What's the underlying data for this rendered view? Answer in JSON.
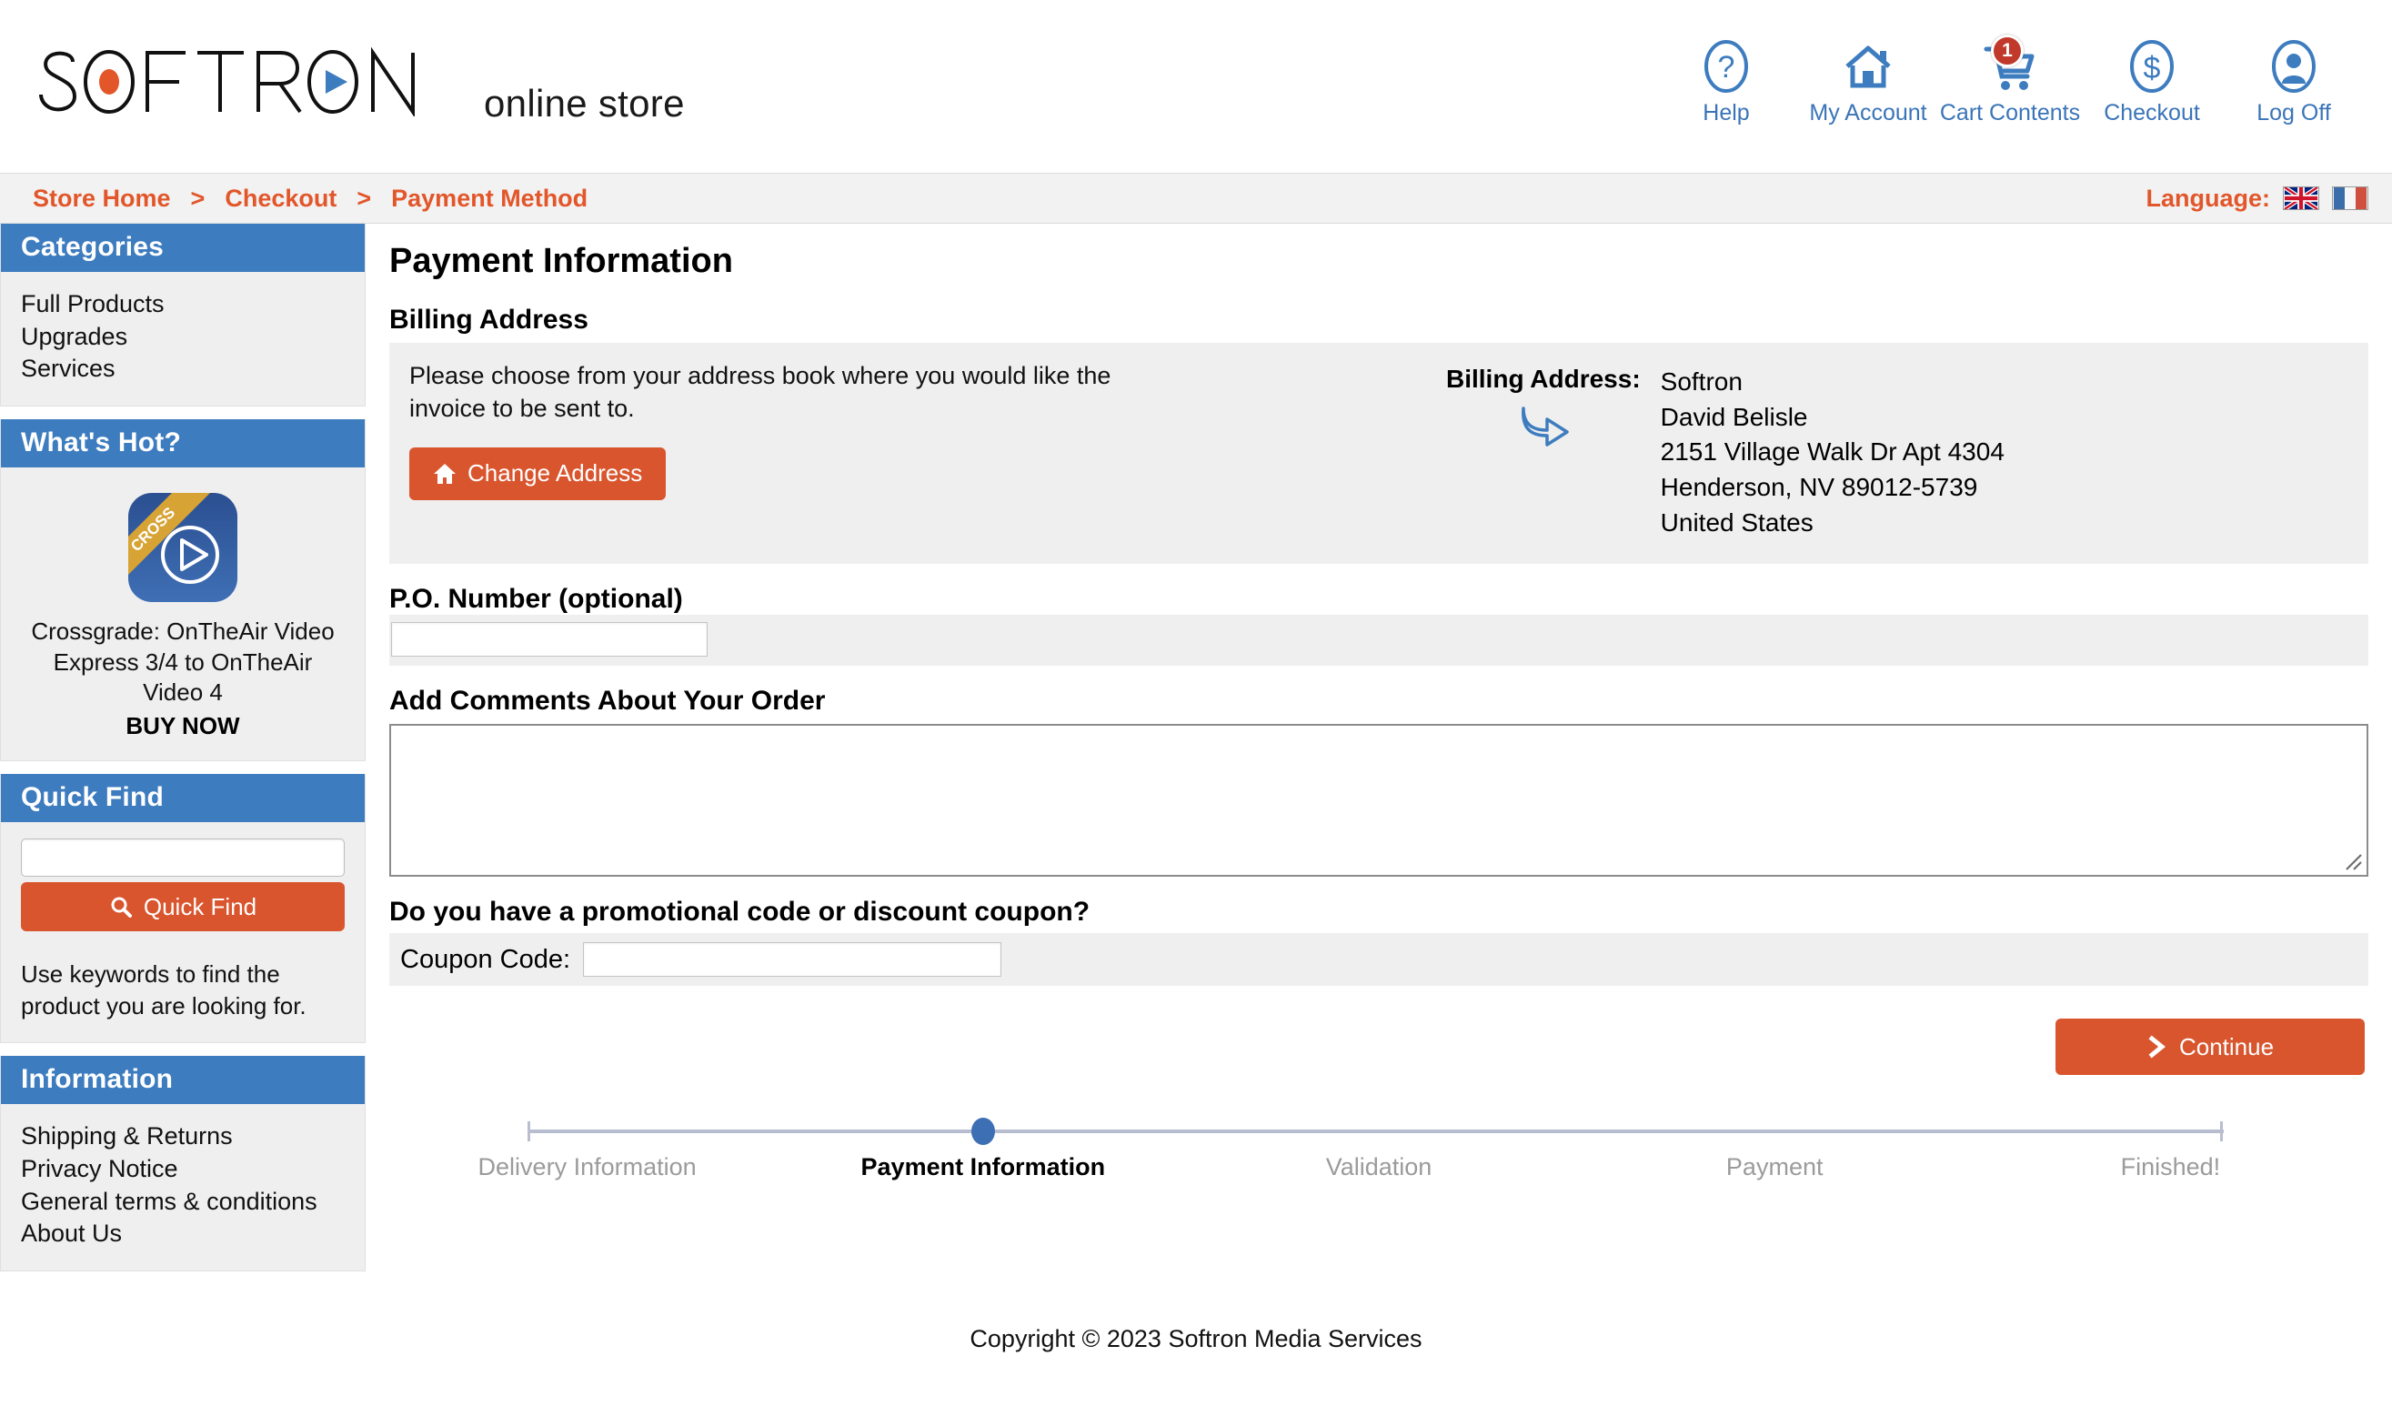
{
  "brand": {
    "logo_text": "SOFTRON",
    "logo_tagline": "online store",
    "accent_orange": "#d9552e",
    "accent_blue": "#3d7cbf",
    "badge_red": "#c0392b"
  },
  "header": {
    "nav": [
      {
        "label": "Help",
        "icon": "help-circle-icon"
      },
      {
        "label": "My Account",
        "icon": "home-icon"
      },
      {
        "label": "Cart Contents",
        "icon": "shopping-cart-icon",
        "badge": "1"
      },
      {
        "label": "Checkout",
        "icon": "dollar-circle-icon"
      },
      {
        "label": "Log Off",
        "icon": "user-circle-icon"
      }
    ]
  },
  "breadcrumb": {
    "items": [
      "Store Home",
      "Checkout",
      "Payment Method"
    ],
    "separator": ">",
    "language_label": "Language:",
    "languages": [
      "english-flag",
      "french-flag"
    ]
  },
  "sidebar": {
    "categories": {
      "title": "Categories",
      "items": [
        "Full Products",
        "Upgrades",
        "Services"
      ]
    },
    "whats_hot": {
      "title": "What's Hot?",
      "product_icon": "onthe-air-video-app-icon",
      "ribbon_text": "CROSS",
      "product_name": "Crossgrade: OnTheAir Video Express 3/4 to OnTheAir Video 4",
      "buy_label": "BUY NOW"
    },
    "quick_find": {
      "title": "Quick Find",
      "input_value": "",
      "input_placeholder": "",
      "button_label": "Quick Find",
      "button_icon": "search-icon",
      "hint": "Use keywords to find the product you are looking for."
    },
    "information": {
      "title": "Information",
      "items": [
        "Shipping & Returns",
        "Privacy Notice",
        "General terms & conditions",
        "About Us"
      ]
    }
  },
  "main": {
    "page_title": "Payment Information",
    "billing": {
      "section_title": "Billing Address",
      "instructions": "Please choose from your address book where you would like the invoice to be sent to.",
      "change_button_label": "Change Address",
      "change_button_icon": "home-icon",
      "address_label": "Billing Address:",
      "arrow_icon": "curved-arrow-right-icon",
      "address_lines": [
        "Softron",
        "David Belisle",
        "2151 Village Walk Dr Apt 4304",
        "Henderson, NV 89012-5739",
        "United States"
      ]
    },
    "po_number": {
      "label": "P.O. Number (optional)",
      "value": "",
      "placeholder": ""
    },
    "comments": {
      "label": "Add Comments About Your Order",
      "value": "",
      "placeholder": ""
    },
    "coupon": {
      "heading": "Do you have a promotional code or discount coupon?",
      "label": "Coupon Code:",
      "value": "",
      "placeholder": ""
    },
    "continue_button": {
      "label": "Continue",
      "icon": "chevron-right-icon"
    },
    "stepper": {
      "steps": [
        "Delivery Information",
        "Payment Information",
        "Validation",
        "Payment",
        "Finished!"
      ],
      "active_index": 1
    }
  },
  "footer": {
    "copyright": "Copyright © 2023 Softron Media Services"
  }
}
